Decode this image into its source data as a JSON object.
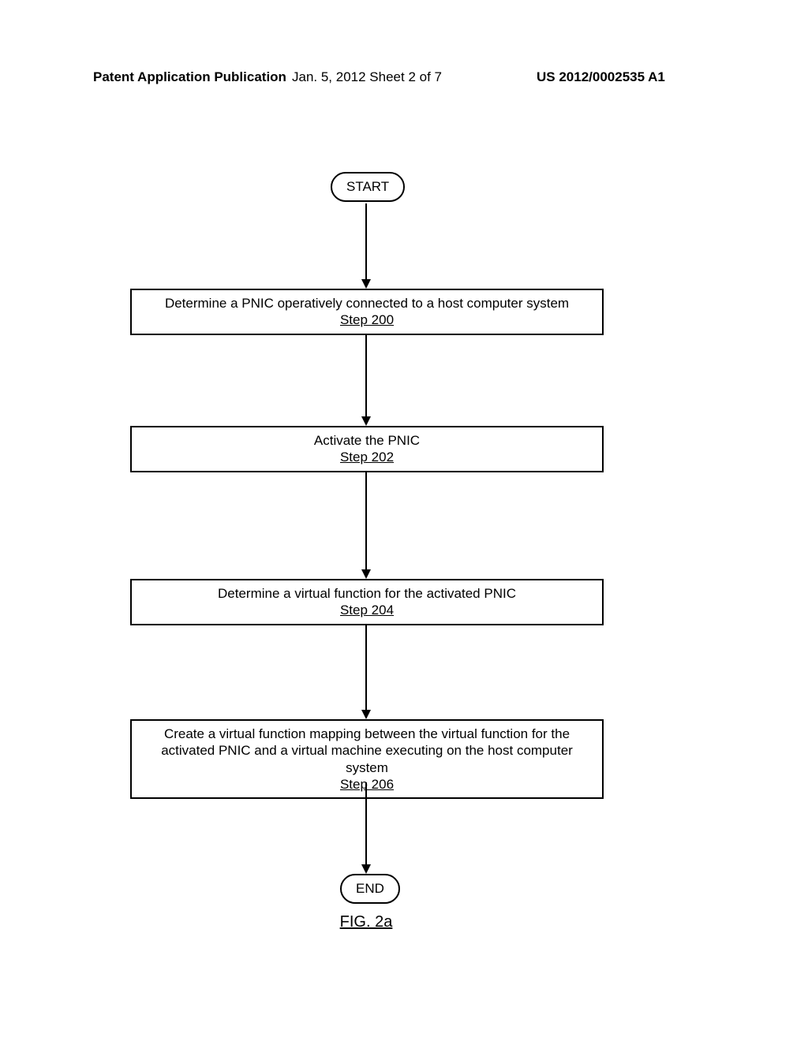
{
  "header": {
    "left": "Patent Application Publication",
    "mid": "Jan. 5, 2012   Sheet 2 of 7",
    "right": "US 2012/0002535 A1"
  },
  "flow": {
    "start": "START",
    "end": "END",
    "step200": {
      "text": "Determine a PNIC operatively connected to a host computer system",
      "label": "Step 200"
    },
    "step202": {
      "text": "Activate the PNIC",
      "label": "Step 202"
    },
    "step204": {
      "text": "Determine a virtual function for the activated PNIC",
      "label": "Step 204"
    },
    "step206": {
      "text": "Create a virtual function mapping between the virtual function for the activated PNIC and a virtual machine executing on the host computer system",
      "label": "Step 206"
    }
  },
  "figure_label": "FIG. 2a"
}
